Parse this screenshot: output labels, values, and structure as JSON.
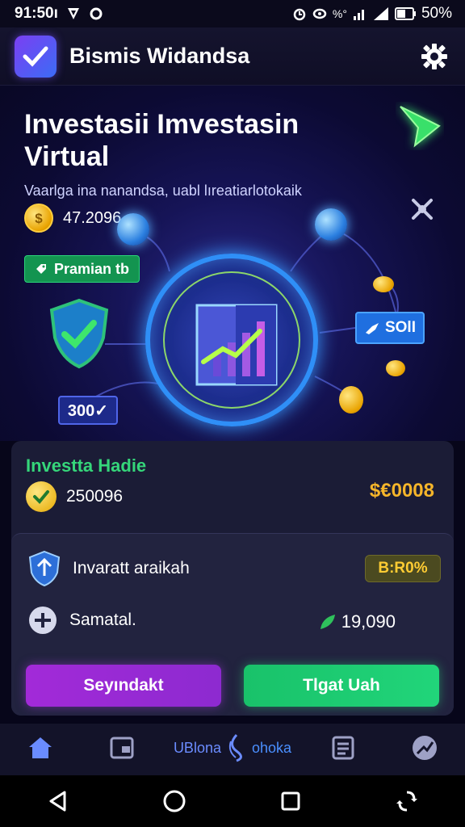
{
  "status_bar": {
    "time": "91:50ı",
    "battery": "50%",
    "signal_text": "%°"
  },
  "header": {
    "title": "Bismis Widandsa",
    "logo_icon": "check-logo-icon",
    "settings_icon": "gear-icon"
  },
  "hero": {
    "title": "Investasii Imvestasin Virtual",
    "subtitle": "Vaarlga ina nanandsa, uabl lıreatiarlotokaik",
    "balance": "47.2096",
    "premium_label": "Pramian tb",
    "value_pill": "SOlI",
    "count_pill": "300✓"
  },
  "dashboard": {
    "title": "Investta Hadie",
    "invested": "250096",
    "amount": "$€0008",
    "rows": [
      {
        "label": "Invaratt araikah",
        "icon": "shield-icon",
        "badge": "B:R0%"
      },
      {
        "label": "Samatal.",
        "icon": "coin-icon",
        "value": "19,090"
      }
    ],
    "buttons": {
      "left": "Seyındakt",
      "right": "Tlgat Uah"
    }
  },
  "bottom_nav": {
    "center_left": "UBlona",
    "center_right": "ohoka",
    "items": [
      "home-icon",
      "wallet-icon",
      "document-icon",
      "chart-icon"
    ]
  },
  "colors": {
    "accent_green": "#21d57a",
    "accent_purple": "#a22ad8",
    "gold": "#f5b52a",
    "bg": "#07061a"
  }
}
